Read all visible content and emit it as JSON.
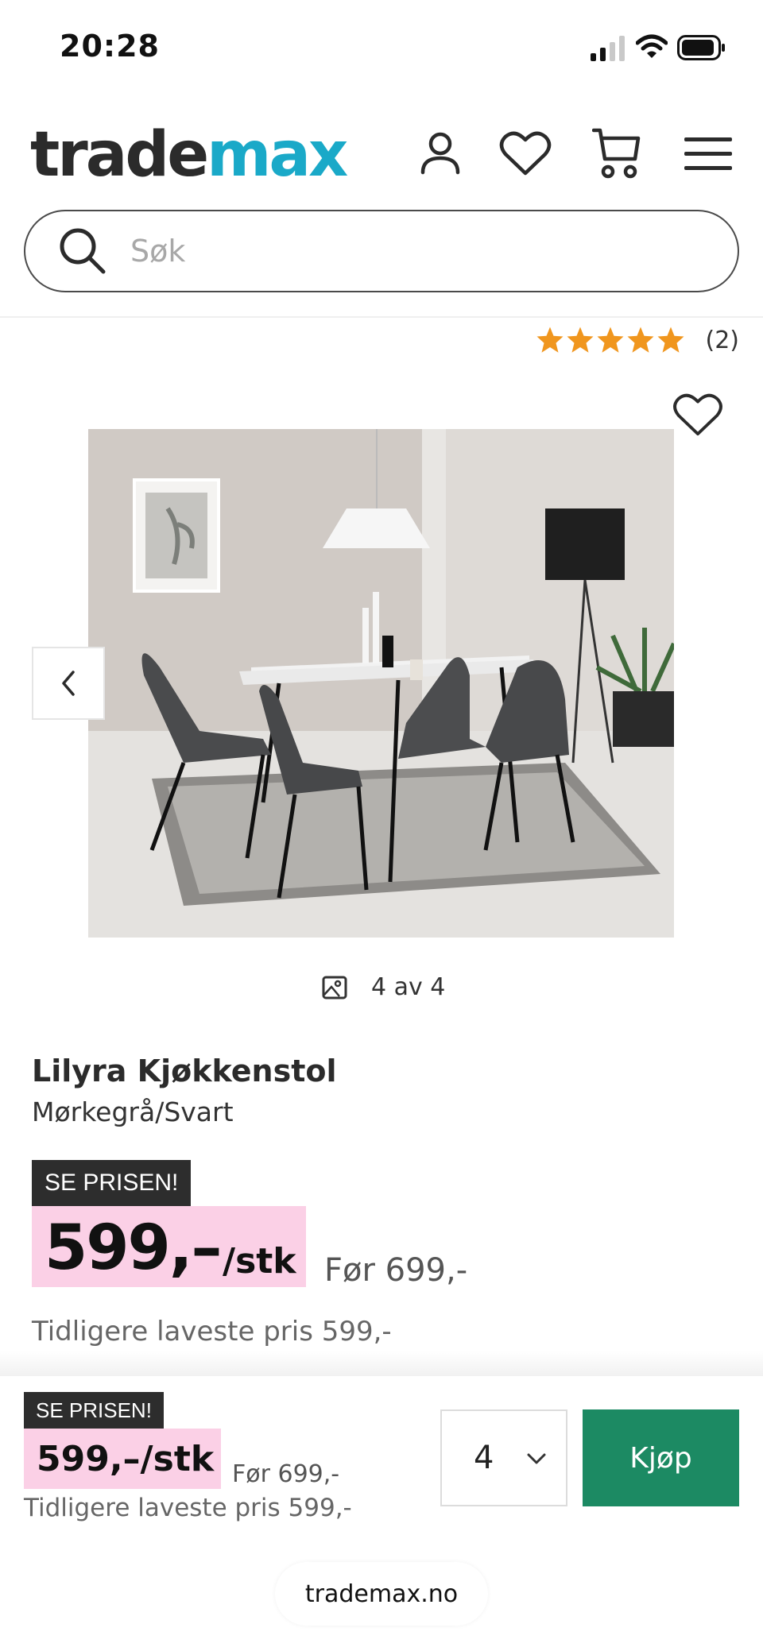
{
  "status_bar": {
    "time": "20:28"
  },
  "header": {
    "logo_part1": "trade",
    "logo_part2": "max",
    "logo_color": "#1aa9c8",
    "icons": [
      "user-icon",
      "heart-icon",
      "cart-icon",
      "menu-icon"
    ]
  },
  "search": {
    "placeholder": "Søk",
    "value": ""
  },
  "rating": {
    "stars": 5,
    "count_label": "(2)",
    "star_color": "#f0961e"
  },
  "gallery": {
    "counter": "4 av 4",
    "current": 4,
    "total": 4
  },
  "product": {
    "name": "Lilyra Kjøkkenstol",
    "variant": "Mørkegrå/Svart",
    "badge": "SE PRISEN!",
    "price": "599,–",
    "unit": "/stk",
    "before_price": "Før 699,-",
    "lowest_price": "Tidligere laveste pris 599,-",
    "price_bg": "#fbd0e6"
  },
  "sticky_bar": {
    "badge": "SE PRISEN!",
    "price": "599,–/stk",
    "before_price": "Før 699,-",
    "lowest_price": "Tidligere laveste pris 599,-",
    "quantity": "4",
    "buy_label": "Kjøp",
    "buy_color": "#1c8a63"
  },
  "browser": {
    "url": "trademax.no"
  }
}
